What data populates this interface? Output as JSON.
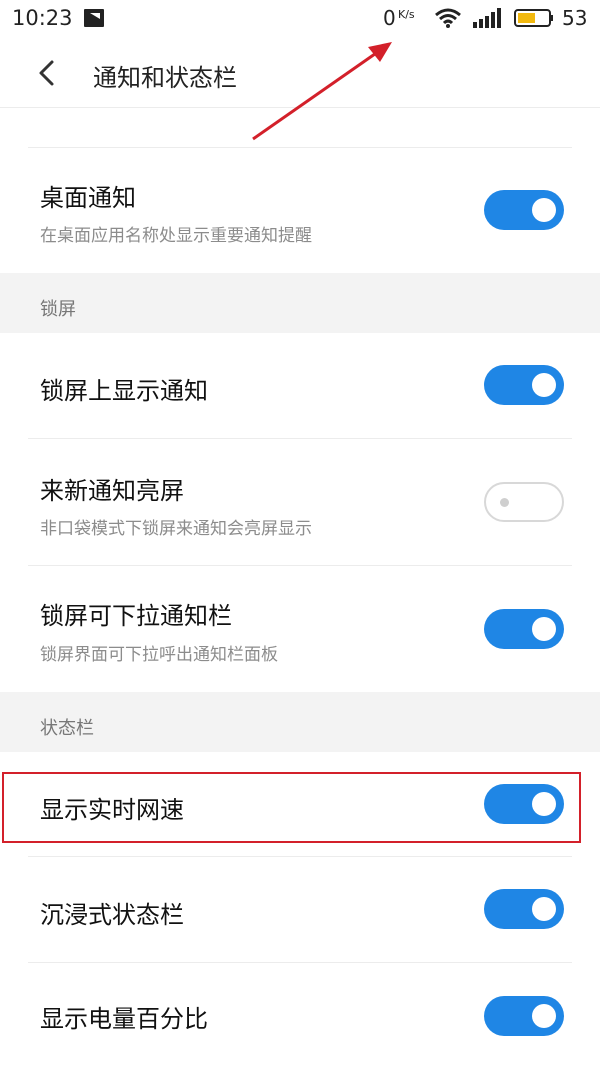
{
  "status_bar": {
    "time": "10:23",
    "net_speed": "0",
    "net_speed_unit": "K/s",
    "battery_percent": "53",
    "icons": [
      "notification-icon",
      "wifi-icon",
      "signal-icon",
      "battery-icon"
    ]
  },
  "header": {
    "title": "通知和状态栏",
    "back_icon": "chevron-left-icon"
  },
  "colors": {
    "toggle_on": "#1f86e5",
    "highlight": "#d3202a",
    "section_bg": "#f3f3f3"
  },
  "items": {
    "desktop_notification": {
      "title": "桌面通知",
      "subtitle": "在桌面应用名称处显示重要通知提醒",
      "enabled": true
    },
    "lockscreen_section": "锁屏",
    "lockscreen_show": {
      "title": "锁屏上显示通知",
      "enabled": true
    },
    "wake_on_notification": {
      "title": "来新通知亮屏",
      "subtitle": "非口袋模式下锁屏来通知会亮屏显示",
      "enabled": false
    },
    "lockscreen_pulldown": {
      "title": "锁屏可下拉通知栏",
      "subtitle": "锁屏界面可下拉呼出通知栏面板",
      "enabled": true
    },
    "statusbar_section": "状态栏",
    "realtime_speed": {
      "title": "显示实时网速",
      "enabled": true
    },
    "immersive_statusbar": {
      "title": "沉浸式状态栏",
      "enabled": true
    },
    "battery_percentage": {
      "title": "显示电量百分比",
      "enabled": true
    }
  }
}
